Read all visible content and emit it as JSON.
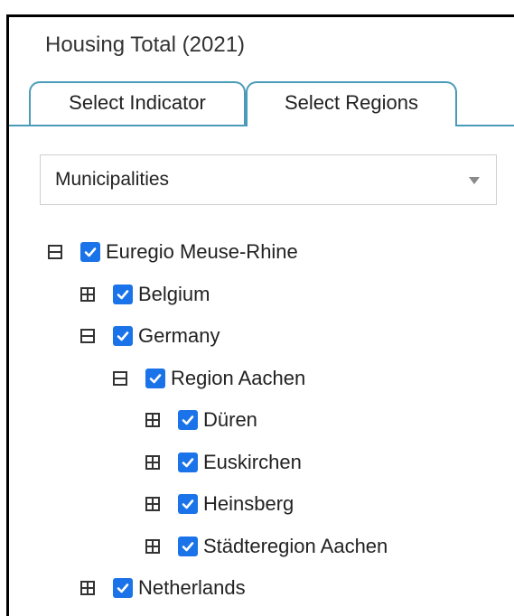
{
  "panel": {
    "title": "Housing Total (2021)"
  },
  "tabs": [
    {
      "label": "Select Indicator",
      "active": false
    },
    {
      "label": "Select Regions",
      "active": true
    }
  ],
  "region_level": {
    "selected": "Municipalities"
  },
  "tree": [
    {
      "label": "Euregio Meuse-Rhine",
      "expanded": true,
      "checked": true,
      "level": 0
    },
    {
      "label": "Belgium",
      "expanded": false,
      "checked": true,
      "level": 1
    },
    {
      "label": "Germany",
      "expanded": true,
      "checked": true,
      "level": 1
    },
    {
      "label": "Region Aachen",
      "expanded": true,
      "checked": true,
      "level": 2
    },
    {
      "label": "Düren",
      "expanded": false,
      "checked": true,
      "level": 3
    },
    {
      "label": "Euskirchen",
      "expanded": false,
      "checked": true,
      "level": 3
    },
    {
      "label": "Heinsberg",
      "expanded": false,
      "checked": true,
      "level": 3
    },
    {
      "label": "Städteregion Aachen",
      "expanded": false,
      "checked": true,
      "level": 3
    },
    {
      "label": "Netherlands",
      "expanded": false,
      "checked": true,
      "level": 1
    }
  ],
  "colors": {
    "tab_border": "#4a9bb8",
    "checkbox": "#1a73e8"
  },
  "icons": {
    "expanded": "minus-square-icon",
    "collapsed": "plus-square-icon",
    "checked": "checkbox-checked-icon",
    "dropdown": "chevron-down-icon"
  }
}
